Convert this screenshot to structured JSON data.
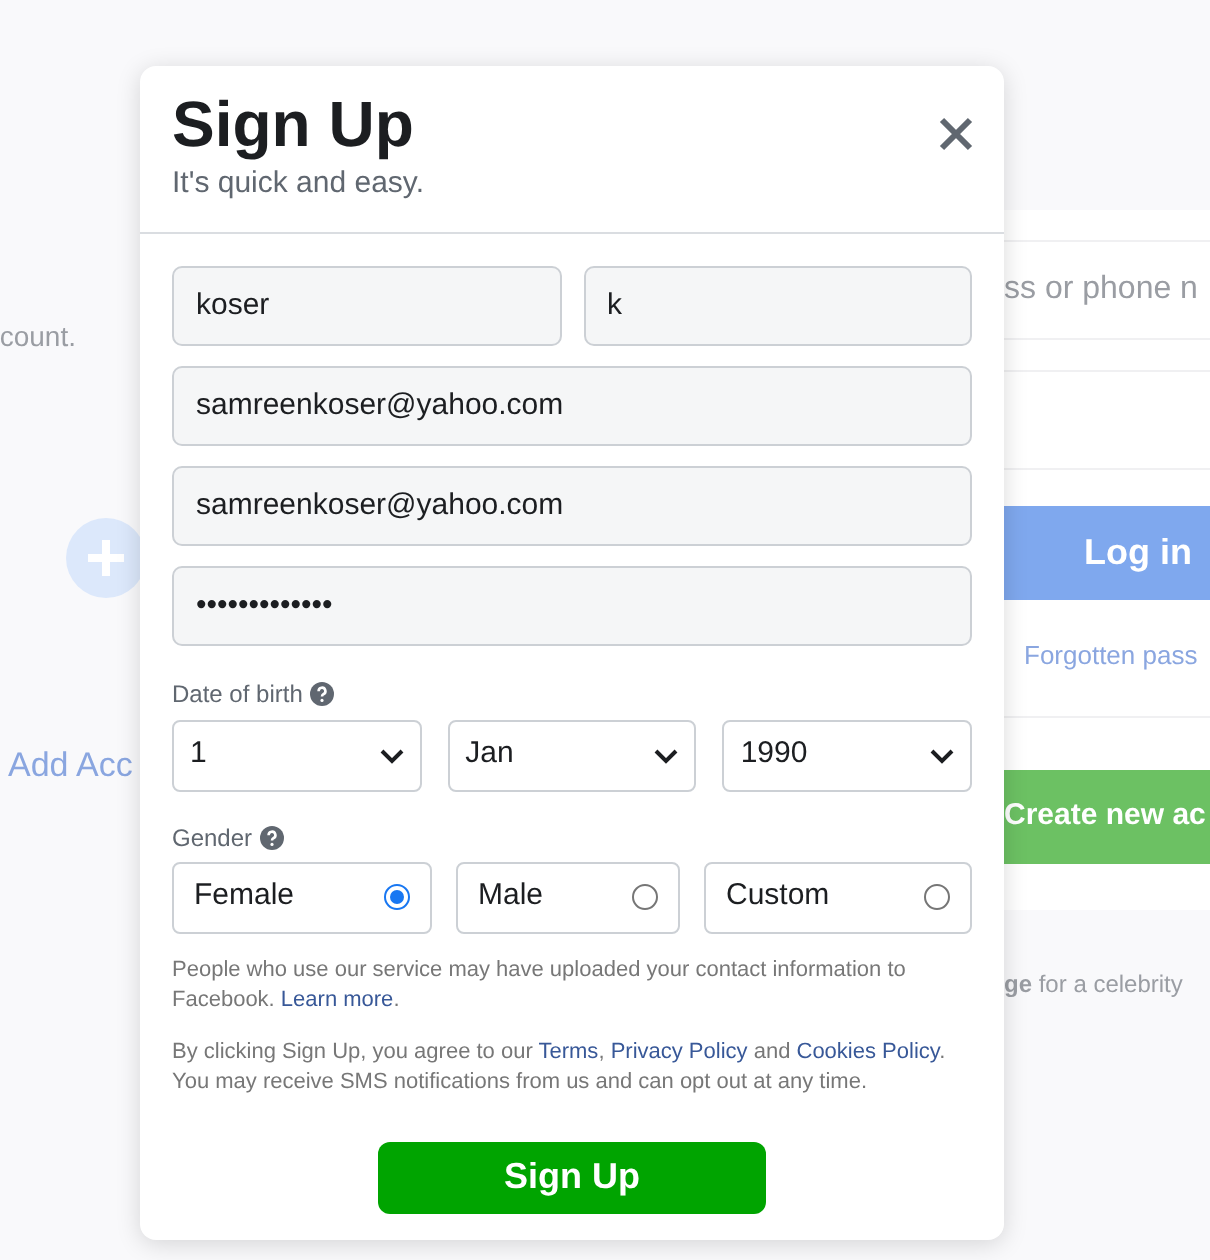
{
  "background": {
    "left_panel": {
      "caption": "count.",
      "add_account": "Add Acc"
    },
    "login_card": {
      "email_placeholder": "ss or phone n",
      "login_button": "Log in",
      "forgotten_link": "Forgotten pass",
      "create_button": "Create new ac"
    },
    "footer_text": "**ge** for a celebrity"
  },
  "dialog": {
    "title": "Sign Up",
    "subtitle": "It's quick and easy.",
    "name_fields": [
      {
        "value": "koser"
      },
      {
        "value": "k"
      }
    ],
    "fields": [
      {
        "value": "samreenkoser@yahoo.com"
      },
      {
        "value": "samreenkoser@yahoo.com"
      },
      {
        "value": "•••••••••••••"
      }
    ],
    "date_of_birth": {
      "label": "Date of birth",
      "selects": [
        {
          "value": "1"
        },
        {
          "value": "Jan"
        },
        {
          "value": "1990"
        }
      ]
    },
    "gender": {
      "label": "Gender",
      "options": [
        {
          "label": "Female",
          "selected": true
        },
        {
          "label": "Male",
          "selected": false
        },
        {
          "label": "Custom",
          "selected": false
        }
      ]
    },
    "notice": [
      {
        "kind": "plain",
        "text": "People who use our service may have uploaded your contact information to Facebook. "
      },
      {
        "kind": "link",
        "text": "Learn more"
      },
      {
        "kind": "plain",
        "text": "."
      }
    ],
    "terms": [
      {
        "kind": "plain",
        "text": "By clicking Sign Up, you agree to our "
      },
      {
        "kind": "link",
        "text": "Terms"
      },
      {
        "kind": "plain",
        "text": ", "
      },
      {
        "kind": "link",
        "text": "Privacy Policy"
      },
      {
        "kind": "plain",
        "text": " and "
      },
      {
        "kind": "link",
        "text": "Cookies Policy"
      },
      {
        "kind": "plain",
        "text": ". You may receive SMS notifications from us and can opt out at any time."
      }
    ],
    "submit_button": "Sign Up"
  }
}
